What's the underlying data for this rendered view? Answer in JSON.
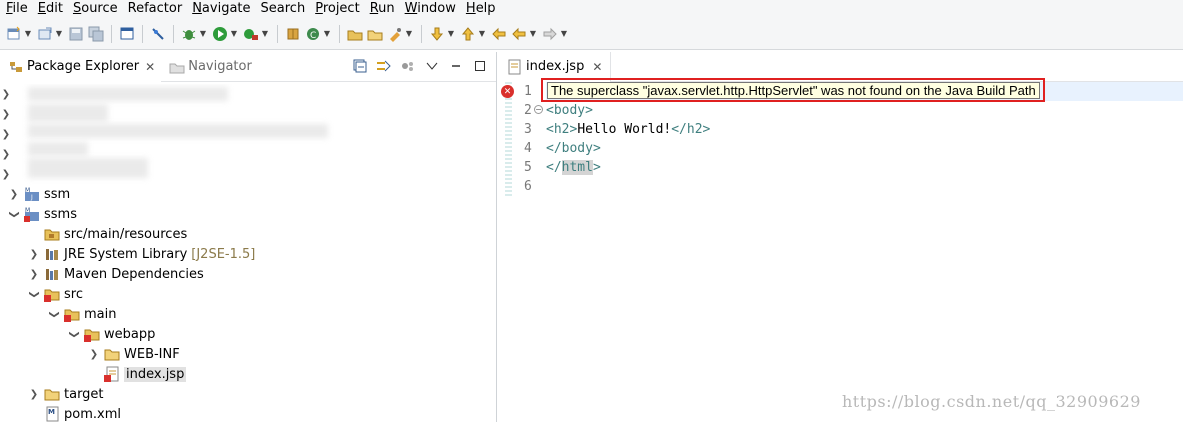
{
  "menu": [
    {
      "label": "File",
      "mn": "F",
      "rest": "ile"
    },
    {
      "label": "Edit",
      "mn": "E",
      "rest": "dit"
    },
    {
      "label": "Source",
      "mn": "S",
      "rest": "ource"
    },
    {
      "label": "Refactor",
      "mn": "",
      "rest": "Refactor"
    },
    {
      "label": "Navigate",
      "mn": "N",
      "rest": "avigate"
    },
    {
      "label": "Search",
      "mn": "",
      "rest": "Search"
    },
    {
      "label": "Project",
      "mn": "P",
      "rest": "roject"
    },
    {
      "label": "Run",
      "mn": "R",
      "rest": "un"
    },
    {
      "label": "Window",
      "mn": "W",
      "rest": "indow"
    },
    {
      "label": "Help",
      "mn": "H",
      "rest": "elp"
    }
  ],
  "left_panel": {
    "tabs": [
      {
        "label": "Package Explorer",
        "close": "✕"
      },
      {
        "label": "Navigator"
      }
    ]
  },
  "tree": [
    {
      "label": "ssm"
    },
    {
      "label": "ssms"
    },
    {
      "label": "src/main/resources"
    },
    {
      "label": "JRE System Library",
      "decoration": "[J2SE-1.5]"
    },
    {
      "label": "Maven Dependencies"
    },
    {
      "label": "src"
    },
    {
      "label": "main"
    },
    {
      "label": "webapp"
    },
    {
      "label": "WEB-INF"
    },
    {
      "label": "index.jsp"
    },
    {
      "label": "target"
    },
    {
      "label": "pom.xml"
    }
  ],
  "editor": {
    "tab_label": "index.jsp",
    "tab_close": "✕",
    "line_numbers": [
      "1",
      "2",
      "3",
      "4",
      "5",
      "6"
    ],
    "tooltip": "The superclass \"javax.servlet.http.HttpServlet\" was not found on the Java Build Path",
    "code": {
      "l2_open": "<",
      "l2_name": "body",
      "l2_close": ">",
      "l3_open": "<",
      "l3_name": "h2",
      "l3_mid": ">",
      "l3_text": "Hello World!",
      "l3_end_open": "</",
      "l3_end_name": "h2",
      "l3_end_close": ">",
      "l4_open": "</",
      "l4_name": "body",
      "l4_close": ">",
      "l5_open": "</",
      "l5_name": "html",
      "l5_close": ">"
    }
  },
  "watermark": "https://blog.csdn.net/qq_32909629",
  "colors": {
    "error": "#d9302c",
    "highlight_box": "#e02020",
    "tag": "#3f7f7f"
  }
}
